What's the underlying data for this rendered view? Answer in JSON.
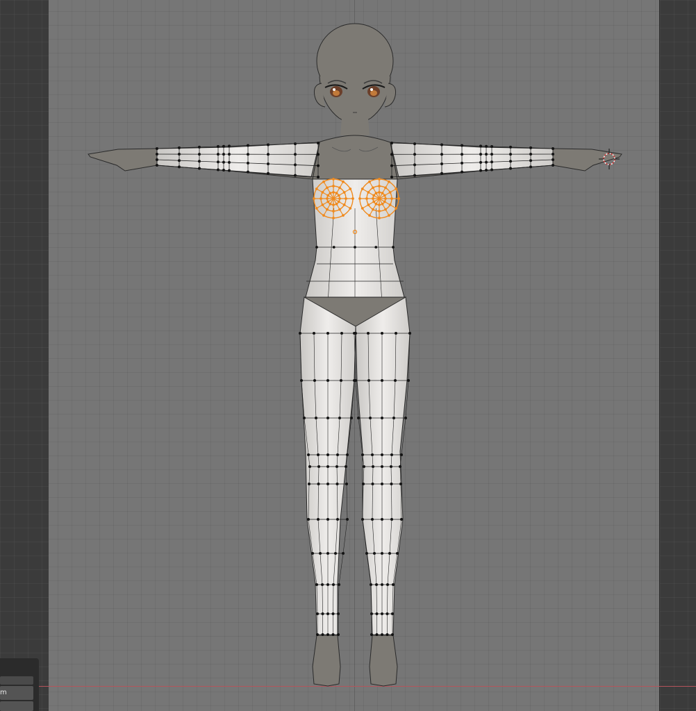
{
  "app": {
    "type": "3d-viewport",
    "mode": "edit-mode",
    "view": "front-orthographic"
  },
  "viewport": {
    "background_color": "#767676",
    "grid_color": "#6c6c6c",
    "x_axis_color": "#b5545b"
  },
  "model": {
    "skin_color": "#7d7a74",
    "cloth_color": "#e8e6e3",
    "edge_color": "#222222",
    "selected_color": "#f08a1d",
    "icons": [
      "3d-cursor-icon",
      "origin-icon"
    ]
  },
  "operator_panel": {
    "field_text": "m"
  }
}
